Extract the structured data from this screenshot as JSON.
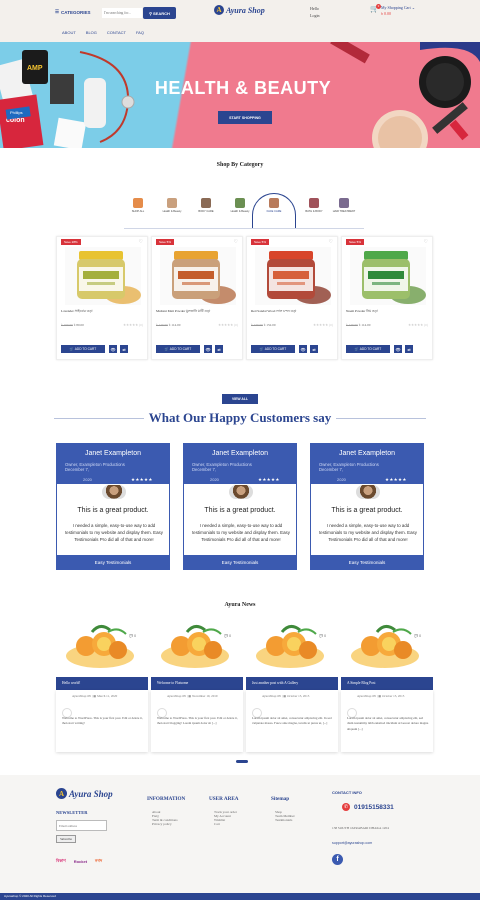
{
  "header": {
    "categories_label": "CATEGORIES",
    "search_placeholder": "I'm searching for...",
    "search_button": "SEARCH",
    "logo_text": "Ayura Shop",
    "logo_mark": "A",
    "hello": "Hello",
    "login": "Login",
    "cart_badge": "0",
    "cart_title": "My Shopping Cart",
    "cart_amount": "৳ 0.00",
    "nav": [
      "ABOUT",
      "BLOG",
      "CONTACT",
      "FAQ"
    ]
  },
  "hero": {
    "title": "HEALTH & BEAUTY",
    "button": "START SHOPPING"
  },
  "categories": {
    "title": "Shop By Category",
    "tabs": [
      {
        "label": "SHOP ALL",
        "color": "#e58c4a"
      },
      {
        "label": "Health & Beauty",
        "color": "#c9a07e"
      },
      {
        "label": "BODY CARE",
        "color": "#8a6a55"
      },
      {
        "label": "Health & Beauty",
        "color": "#6b8f52"
      },
      {
        "label": "FACE CARE",
        "color": "#b87a5a"
      },
      {
        "label": "BATH & BODY",
        "color": "#a0525a"
      },
      {
        "label": "HAIR TREATMENT",
        "color": "#7a6a8f"
      }
    ]
  },
  "products": [
    {
      "sale": "Save 28%",
      "name": "Lavender সাইবোর ওড়া",
      "old_price": "৳ 100.00",
      "price": "৳ 80.00",
      "lid": "#e8c331",
      "body": "#d7c96a",
      "label": "#a4af3c",
      "accent": "#e6b04d"
    },
    {
      "sale": "Save 5%",
      "name": "Multani Mati Powder মুলতানি মাটি ওড়া",
      "old_price": "৳ 120.00",
      "price": "৳ 114.00",
      "lid": "#e8a331",
      "body": "#caa07a",
      "label": "#c45d2b",
      "accent": "#b77049"
    },
    {
      "sale": "Save 5%",
      "name": "Red Sandal Wood লাল চন্দন ওড়া",
      "old_price": "৳ 170.00",
      "price": "৳ 152.00",
      "lid": "#d8452a",
      "body": "#b24a3a",
      "label": "#d6603a",
      "accent": "#8b3a2b"
    },
    {
      "sale": "Save 5%",
      "name": "Neem Powder নিম ওড়া",
      "old_price": "৳ 120.00",
      "price": "৳ 114.00",
      "lid": "#4fa84a",
      "body": "#9cbf6a",
      "label": "#2f8a3a",
      "accent": "#6c9c4a"
    }
  ],
  "product_actions": {
    "add_to_cart": "ADD TO CART",
    "stars": "★★★★★",
    "rating": "(0)"
  },
  "view_all": "VIEW ALL",
  "testimonials": {
    "title": "What Our Happy Customers say",
    "items": [
      {
        "name": "Janet Exampleton",
        "role": "Owner, Exampleton Productions",
        "date_line1": "December 7,",
        "date_line2": "2020",
        "stars": "★★★★★",
        "quote": "This is a great product.",
        "body": "I needed a simple, easy-to-use way to add testimonials to my website and display them. Easy Testimonials Pro did all of that and more!",
        "footer": "Easy Testimonials"
      },
      {
        "name": "Janet Exampleton",
        "role": "Owner, Exampleton Productions",
        "date_line1": "December 7,",
        "date_line2": "2020",
        "stars": "★★★★★",
        "quote": "This is a great product.",
        "body": "I needed a simple, easy-to-use way to add testimonials to my website and display them. Easy Testimonials Pro did all of that and more!",
        "footer": "Easy Testimonials"
      },
      {
        "name": "Janet Exampleton",
        "role": "Owner, Exampleton Productions",
        "date_line1": "December 7,",
        "date_line2": "2020",
        "stars": "★★★★★",
        "quote": "This is a great product.",
        "body": "I needed a simple, easy-to-use way to add testimonials to my website and display them. Easy Testimonials Pro did all of that and more!",
        "footer": "Easy Testimonials"
      }
    ]
  },
  "news": {
    "title": "Ayura News",
    "items": [
      {
        "count": "0",
        "title": "Hello world!",
        "author": "AyuraShop105",
        "date": "March 11, 2020",
        "text": "Welcome to WordPress. This is your first post. Edit or delete it, then start writing!"
      },
      {
        "count": "0",
        "title": "Welcome to Flatsome",
        "author": "AyuraShop105",
        "date": "November 19, 2019",
        "text": "Welcome to WordPress. This is your first post. Edit or delete it, then start blogging! Lorem ipsum dolor sit [...]"
      },
      {
        "count": "0",
        "title": "Just another post with A Gallery",
        "author": "AyuraShop105",
        "date": "October 15, 2015",
        "text": "Lorem ipsum dolor sit amet, consectetur adipiscing elit. In sed vulputate massa. Fusce ante magna, iaculis ut purus ut, [...]"
      },
      {
        "count": "0",
        "title": "A Simple Blog Post",
        "author": "AyuraShop105",
        "date": "October 15, 2015",
        "text": "Lorem ipsum dolor sit amet, consectetur adipiscing elit, sed diam nonummy nibh euismod tincidunt ut laoreet dolore magna aliquam [...]"
      }
    ]
  },
  "footer": {
    "logo_text": "Ayura Shop",
    "logo_mark": "A",
    "newsletter_title": "NEWSLETTER",
    "email_placeholder": "Email address",
    "subscribe": "Subscribe",
    "payments": [
      "বিকাশ",
      "Rocket",
      "নগদ"
    ],
    "information": {
      "title": "INFORMATION",
      "links": [
        "About",
        "FAQ",
        "Term & conditions",
        "Privacy policy"
      ]
    },
    "user_area": {
      "title": "USER AREA",
      "links": [
        "Track your order",
        "My Account",
        "Wishlist",
        "Cart"
      ]
    },
    "sitemap": {
      "title": "Sitemap",
      "links": [
        "Shop",
        "Team Member",
        "Testimonials"
      ]
    },
    "contact": {
      "title": "CONTACT INFO",
      "phone": "01915158331",
      "address": "138 SOUTH JATRABARI DHAKA 1204",
      "email": "support@ayurashop.com"
    },
    "copyright": "Ayurashop © 2020 All Rights Reserved"
  }
}
